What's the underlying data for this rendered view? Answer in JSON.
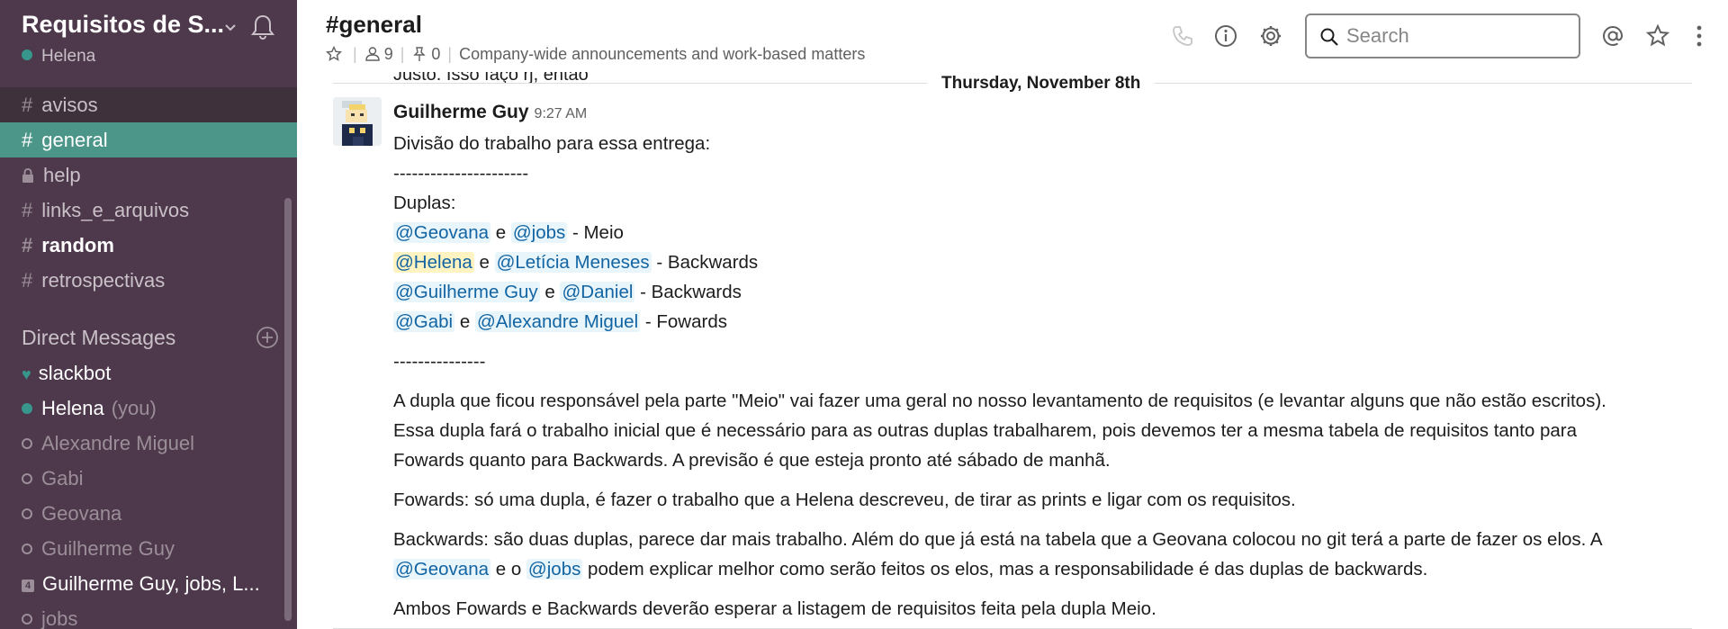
{
  "workspace": {
    "name": "Requisitos de S...",
    "user": "Helena"
  },
  "channels": [
    {
      "name": "avisos"
    },
    {
      "name": "general"
    },
    {
      "name": "help"
    },
    {
      "name": "links_e_arquivos"
    },
    {
      "name": "random"
    },
    {
      "name": "retrospectivas"
    }
  ],
  "dm_section": {
    "title": "Direct Messages"
  },
  "dms": [
    {
      "name": "slackbot"
    },
    {
      "name": "Helena",
      "suffix": "(you)"
    },
    {
      "name": "Alexandre Miguel"
    },
    {
      "name": "Gabi"
    },
    {
      "name": "Geovana"
    },
    {
      "name": "Guilherme Guy"
    },
    {
      "name": "Guilherme Guy, jobs, L...",
      "badge": "4"
    },
    {
      "name": "jobs"
    }
  ],
  "header": {
    "channel": "#general",
    "members": "9",
    "pins": "0",
    "topic": "Company-wide announcements and work-based matters",
    "search_placeholder": "Search"
  },
  "conversation": {
    "clipped_previous": "Justo. Isso faço rj, então",
    "day_divider": "Thursday, November 8th",
    "message": {
      "author": "Guilherme Guy",
      "time": "9:27 AM",
      "intro": "Divisão do trabalho para essa entrega:",
      "rule1": "----------------------",
      "pairs_label": "Duplas:",
      "pairs": [
        {
          "a": "@Geovana",
          "b": "@jobs",
          "role": "- Meio"
        },
        {
          "a": "@Helena",
          "b": "@Letícia Meneses",
          "role": "- Backwards"
        },
        {
          "a": "@Guilherme Guy",
          "b": "@Daniel",
          "role": "- Backwards"
        },
        {
          "a": "@Gabi",
          "b": "@Alexandre Miguel",
          "role": "- Fowards"
        }
      ],
      "conj": "e",
      "rule2": "---------------",
      "p1_line1": "A dupla que ficou responsável pela parte \"Meio\" vai fazer uma geral no nosso levantamento de requisitos (e levantar alguns que não estão escritos).",
      "p1_line2": "Essa dupla fará o trabalho inicial que é necessário para as outras duplas trabalharem, pois devemos ter a mesma tabela de requisitos tanto para",
      "p1_line3": "Fowards quanto para Backwards. A previsão é que esteja pronto até sábado de manhã.",
      "p2": "Fowards: só uma dupla, é fazer o trabalho que a Helena descreveu, de tirar as prints e ligar com os requisitos.",
      "p3_line1": "Backwards: são duas duplas, parece dar mais trabalho. Além do que já está na tabela que a Geovana colocou no git terá a parte de fazer os elos. A",
      "p3_m1": "@Geovana",
      "p3_mid": "e o",
      "p3_m2": "@jobs",
      "p3_rest": "podem explicar melhor como serão feitos os elos, mas a responsabilidade é das duplas de backwards.",
      "p4": "Ambos Fowards e Backwards deverão esperar a listagem de requisitos feita pela dupla Meio."
    }
  },
  "colors": {
    "sidebar_bg": "#4d394b",
    "active_channel": "#4c9689",
    "presence_active": "#38978d",
    "mention": "#1264a3",
    "mention_bg": "#e8f5fa",
    "self_mention_bg": "#fff3c2"
  }
}
